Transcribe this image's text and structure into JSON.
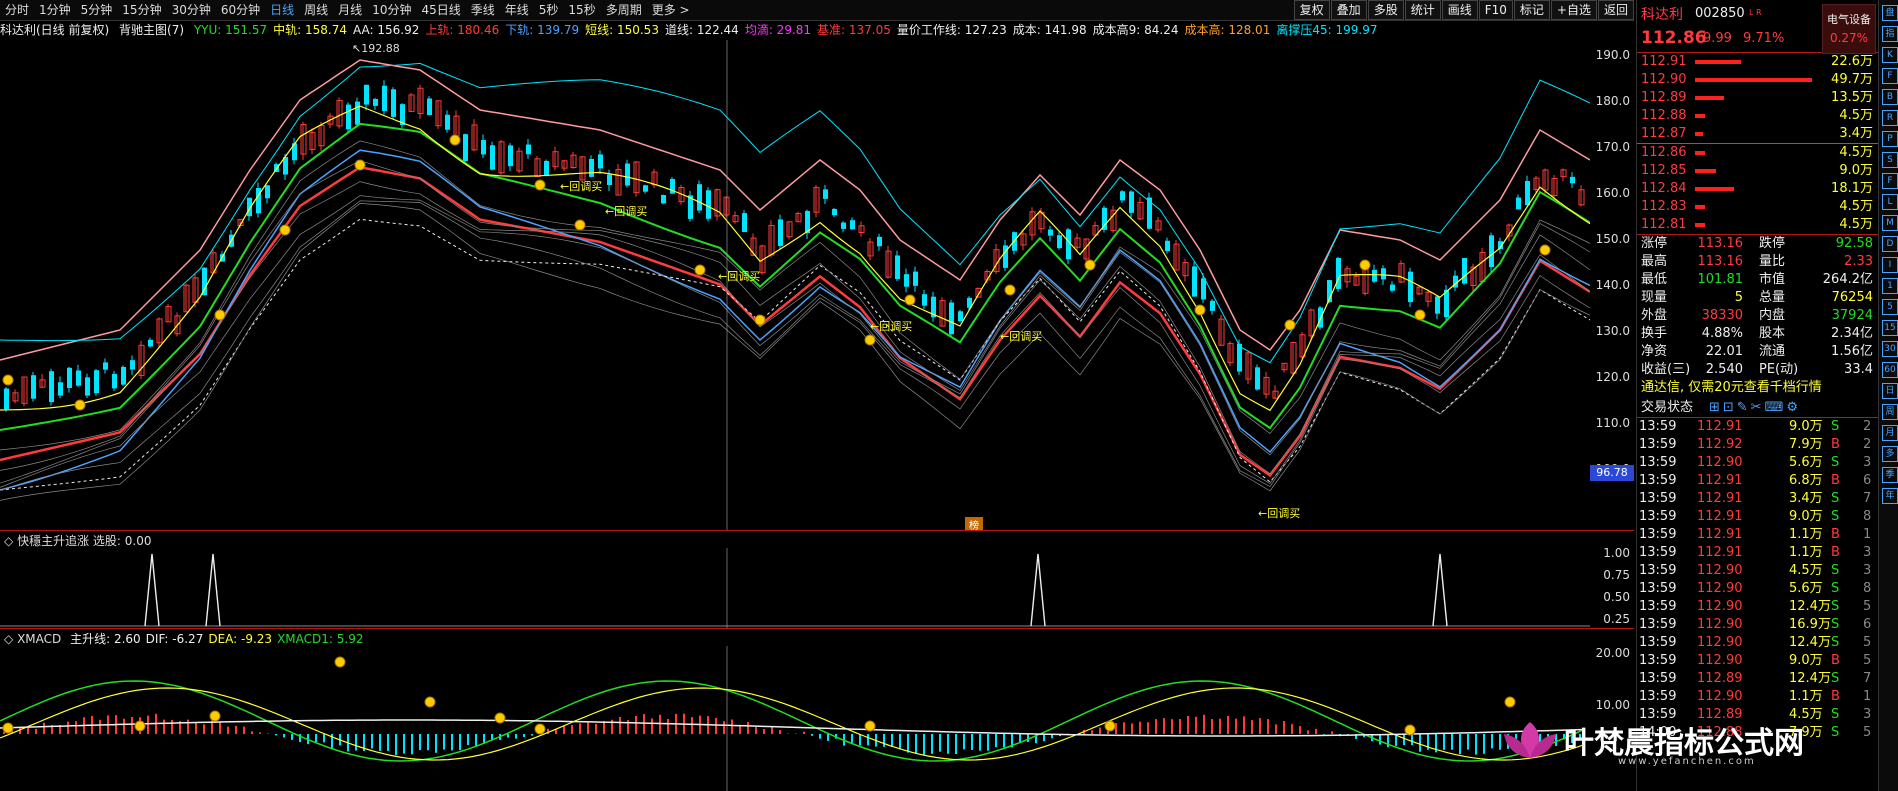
{
  "toolbar": {
    "periods": [
      "分时",
      "1分钟",
      "5分钟",
      "15分钟",
      "30分钟",
      "60分钟",
      "日线",
      "周线",
      "月线",
      "10分钟",
      "45日线",
      "季线",
      "年线",
      "5秒",
      "15秒",
      "多周期",
      "更多 >"
    ],
    "active_period": "日线",
    "right_buttons": [
      "复权",
      "叠加",
      "多股",
      "统计",
      "画线",
      "F10",
      "标记",
      "+自选",
      "返回"
    ]
  },
  "main_chart": {
    "title": "科达利(日线 前复权)",
    "indicator_name": "背驰主图(7)",
    "legend": [
      {
        "label": "YYU: 151.57",
        "color": "#22dd22"
      },
      {
        "label": "中轨: 158.74",
        "color": "#ffff33"
      },
      {
        "label": "AA: 156.92",
        "color": "#eeeeee"
      },
      {
        "label": "上轨: 180.46",
        "color": "#ff3b3b"
      },
      {
        "label": "下轨: 139.79",
        "color": "#4aa3ff"
      },
      {
        "label": "短线: 150.53",
        "color": "#ffff33"
      },
      {
        "label": "道线: 122.44",
        "color": "#eeeeee"
      },
      {
        "label": "均滴: 29.81",
        "color": "#ff33ff"
      },
      {
        "label": "基准: 137.05",
        "color": "#ff3b3b"
      },
      {
        "label": "量价工作线: 127.23",
        "color": "#eeeeee"
      },
      {
        "label": "成本: 141.98",
        "color": "#eeeeee"
      },
      {
        "label": "成本高9: 84.24",
        "color": "#eeeeee"
      },
      {
        "label": "成本高: 128.01",
        "color": "#ffa020"
      },
      {
        "label": "离撑压45: 199.97",
        "color": "#00e5ff"
      }
    ],
    "high_marker": "192.88",
    "y_axis": [
      "190.0",
      "180.0",
      "170.0",
      "160.0",
      "150.0",
      "140.0",
      "130.0",
      "120.0",
      "110.0",
      "100.0"
    ],
    "current_price_tag": "96.78",
    "signals": [
      "回调买",
      "回调买",
      "回调买",
      "回调买",
      "回调买",
      "回调买"
    ],
    "bottom_label": "榜"
  },
  "panel2": {
    "title": "快穩主升追涨",
    "value_label": "选股: 0.00",
    "y_axis": [
      "1.00",
      "0.75",
      "0.50",
      "0.25"
    ]
  },
  "panel3": {
    "title": "XMACD",
    "legend": [
      {
        "label": "主升线: 2.60",
        "color": "#eeeeee"
      },
      {
        "label": "DIF: -6.27",
        "color": "#eeeeee"
      },
      {
        "label": "DEA: -9.23",
        "color": "#ffff33"
      },
      {
        "label": "XMACD1: 5.92",
        "color": "#22dd22"
      }
    ],
    "y_axis": [
      "20.00",
      "10.00"
    ]
  },
  "quote": {
    "stock_name": "科达利",
    "code": "002850",
    "flag": "L R",
    "industry": "电气设备",
    "industry_change": "0.27%",
    "price": "112.86",
    "change": "9.99",
    "change_pct": "9.71%",
    "asks": [
      {
        "price": "112.91",
        "vol": "22.6万",
        "bar": 0.35
      },
      {
        "price": "112.90",
        "vol": "49.7万",
        "bar": 0.9
      },
      {
        "price": "112.89",
        "vol": "13.5万",
        "bar": 0.22
      },
      {
        "price": "112.88",
        "vol": "4.5万",
        "bar": 0.08
      },
      {
        "price": "112.87",
        "vol": "3.4万",
        "bar": 0.06
      }
    ],
    "bids": [
      {
        "price": "112.86",
        "vol": "4.5万",
        "bar": 0.08
      },
      {
        "price": "112.85",
        "vol": "9.0万",
        "bar": 0.16
      },
      {
        "price": "112.84",
        "vol": "18.1万",
        "bar": 0.3
      },
      {
        "price": "112.83",
        "vol": "4.5万",
        "bar": 0.08
      },
      {
        "price": "112.81",
        "vol": "4.5万",
        "bar": 0.08
      }
    ],
    "stats": [
      {
        "l1": "涨停",
        "v1": "113.16",
        "c1": "#ff3b3b",
        "l2": "跌停",
        "v2": "92.58",
        "c2": "#22dd22"
      },
      {
        "l1": "最高",
        "v1": "113.16",
        "c1": "#ff3b3b",
        "l2": "量比",
        "v2": "2.33",
        "c2": "#ff3b3b"
      },
      {
        "l1": "最低",
        "v1": "101.81",
        "c1": "#22dd22",
        "l2": "市值",
        "v2": "264.2亿",
        "c2": "#eeeeee"
      },
      {
        "l1": "现量",
        "v1": "5",
        "c1": "#ffff33",
        "l2": "总量",
        "v2": "76254",
        "c2": "#ffff33"
      },
      {
        "l1": "外盘",
        "v1": "38330",
        "c1": "#ff3b3b",
        "l2": "内盘",
        "v2": "37924",
        "c2": "#22dd22"
      },
      {
        "l1": "换手",
        "v1": "4.88%",
        "c1": "#eeeeee",
        "l2": "股本",
        "v2": "2.34亿",
        "c2": "#eeeeee"
      },
      {
        "l1": "净资",
        "v1": "22.01",
        "c1": "#eeeeee",
        "l2": "流通",
        "v2": "1.56亿",
        "c2": "#eeeeee"
      },
      {
        "l1": "收益(三)",
        "v1": "2.540",
        "c1": "#eeeeee",
        "l2": "PE(动)",
        "v2": "33.4",
        "c2": "#eeeeee"
      }
    ],
    "promo": "通达信, 仅需20元查看千档行情",
    "trade_status": "交易状态",
    "ticks": [
      {
        "t": "13:59",
        "p": "112.91",
        "v": "9.0万",
        "s": "S",
        "n": "2"
      },
      {
        "t": "13:59",
        "p": "112.92",
        "v": "7.9万",
        "s": "B",
        "n": "2"
      },
      {
        "t": "13:59",
        "p": "112.90",
        "v": "5.6万",
        "s": "S",
        "n": "3"
      },
      {
        "t": "13:59",
        "p": "112.91",
        "v": "6.8万",
        "s": "B",
        "n": "6"
      },
      {
        "t": "13:59",
        "p": "112.91",
        "v": "3.4万",
        "s": "S",
        "n": "7"
      },
      {
        "t": "13:59",
        "p": "112.91",
        "v": "9.0万",
        "s": "S",
        "n": "8"
      },
      {
        "t": "13:59",
        "p": "112.91",
        "v": "1.1万",
        "s": "B",
        "n": "1"
      },
      {
        "t": "13:59",
        "p": "112.91",
        "v": "1.1万",
        "s": "B",
        "n": "3"
      },
      {
        "t": "13:59",
        "p": "112.90",
        "v": "4.5万",
        "s": "S",
        "n": "3"
      },
      {
        "t": "13:59",
        "p": "112.90",
        "v": "5.6万",
        "s": "S",
        "n": "8"
      },
      {
        "t": "13:59",
        "p": "112.90",
        "v": "12.4万",
        "s": "S",
        "n": "5"
      },
      {
        "t": "13:59",
        "p": "112.90",
        "v": "16.9万",
        "s": "S",
        "n": "6"
      },
      {
        "t": "13:59",
        "p": "112.90",
        "v": "12.4万",
        "s": "S",
        "n": "5"
      },
      {
        "t": "13:59",
        "p": "112.90",
        "v": "9.0万",
        "s": "B",
        "n": "5"
      },
      {
        "t": "13:59",
        "p": "112.89",
        "v": "12.4万",
        "s": "S",
        "n": "7"
      },
      {
        "t": "13:59",
        "p": "112.90",
        "v": "1.1万",
        "s": "B",
        "n": "1"
      },
      {
        "t": "13:59",
        "p": "112.89",
        "v": "4.5万",
        "s": "S",
        "n": "3"
      },
      {
        "t": "14:00",
        "p": "112.88",
        "v": "7.9万",
        "s": "S",
        "n": "5"
      }
    ]
  },
  "side_icons": [
    "盘",
    "指",
    "K",
    "F",
    "B",
    "R",
    "P",
    "S",
    "F",
    "L",
    "M",
    "D",
    "I",
    "1",
    "5",
    "15",
    "30",
    "60",
    "日",
    "周",
    "月",
    "多",
    "季",
    "年"
  ],
  "watermark": {
    "text": "叶梵晨指标公式网",
    "url": "www.yefanchen.com",
    "sub": "指标公式网"
  },
  "colors": {
    "up": "#ff3b3b",
    "down": "#00e5ff",
    "bg": "#000000"
  }
}
